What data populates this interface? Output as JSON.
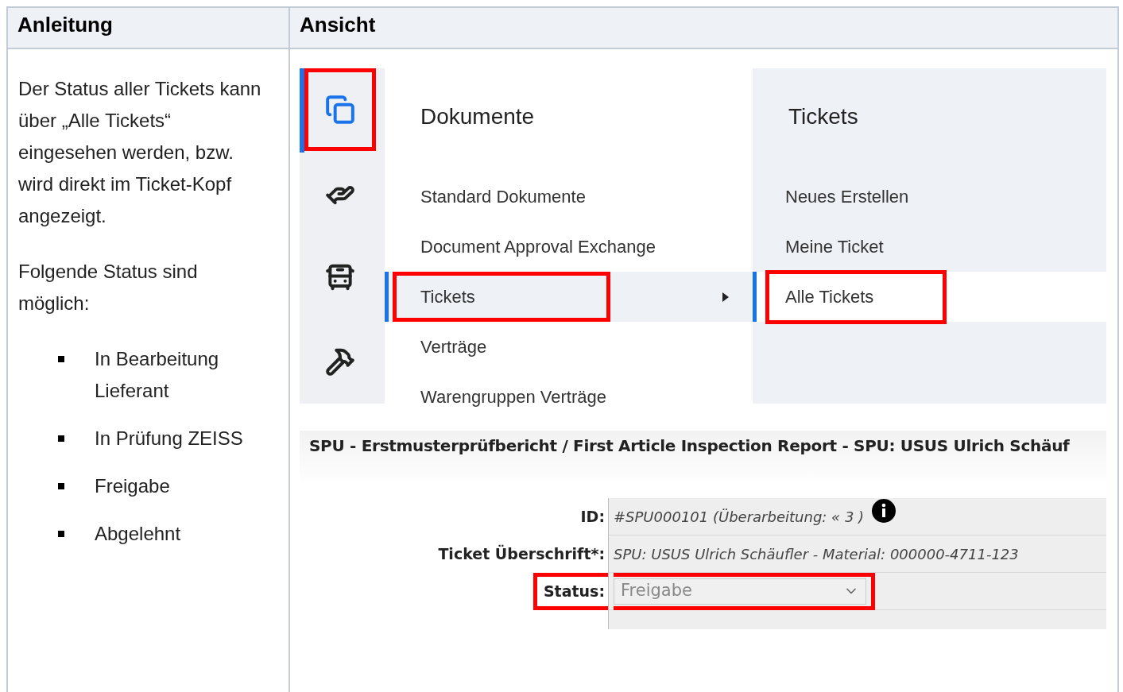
{
  "table": {
    "columns": [
      "Anleitung",
      "Ansicht"
    ],
    "instructions": {
      "paragraphs": [
        "Der Status aller Tickets kann über „Alle Tickets“ eingesehen werden, bzw. wird direkt im Ticket-Kopf angezeigt.",
        "Folgende Status sind möglich:"
      ],
      "bullets": [
        "In Bearbeitung Lieferant",
        "In Prüfung ZEISS",
        "Freigabe",
        "Abgelehnt"
      ]
    },
    "menu": {
      "sidebar": [
        {
          "selected": true,
          "highlighted": true
        },
        {
          "selected": false,
          "highlighted": false
        },
        {
          "selected": false,
          "highlighted": false
        },
        {
          "selected": false,
          "highlighted": false
        }
      ],
      "column_1": {
        "title": "Dokumente",
        "items": [
          {
            "label": "Standard Dokumente",
            "selected": false,
            "highlighted": false,
            "submenu": false
          },
          {
            "label": "Document Approval Exchange",
            "selected": false,
            "highlighted": false,
            "submenu": false
          },
          {
            "label": "Tickets",
            "selected": true,
            "highlighted": true,
            "submenu": true
          },
          {
            "label": "Verträge",
            "selected": false,
            "highlighted": false,
            "submenu": false
          },
          {
            "label": "Warengruppen Verträge",
            "selected": false,
            "highlighted": false,
            "submenu": false
          }
        ]
      },
      "column_2": {
        "title": "Tickets",
        "items": [
          {
            "label": "Neues Erstellen",
            "selected": false,
            "highlighted": false
          },
          {
            "label": "Meine Ticket",
            "selected": false,
            "highlighted": false
          },
          {
            "label": "Alle Tickets",
            "selected": true,
            "highlighted": true
          }
        ]
      }
    },
    "ticket": {
      "title": "SPU - Erstmusterprüfbericht / First Article Inspection Report - SPU: USUS Ulrich Schäuf",
      "fields": [
        {
          "kind": "text",
          "label": "ID:",
          "value": "#SPU000101 (Überarbeitung: « 3 )",
          "info": true,
          "highlighted": false
        },
        {
          "kind": "text",
          "label": "Ticket Überschrift*:",
          "value": "SPU: USUS Ulrich Schäufler - Material: 000000-4711-123",
          "info": false,
          "highlighted": false
        },
        {
          "kind": "select",
          "label": "Status:",
          "value": "Freigabe",
          "highlighted": true
        }
      ]
    }
  }
}
